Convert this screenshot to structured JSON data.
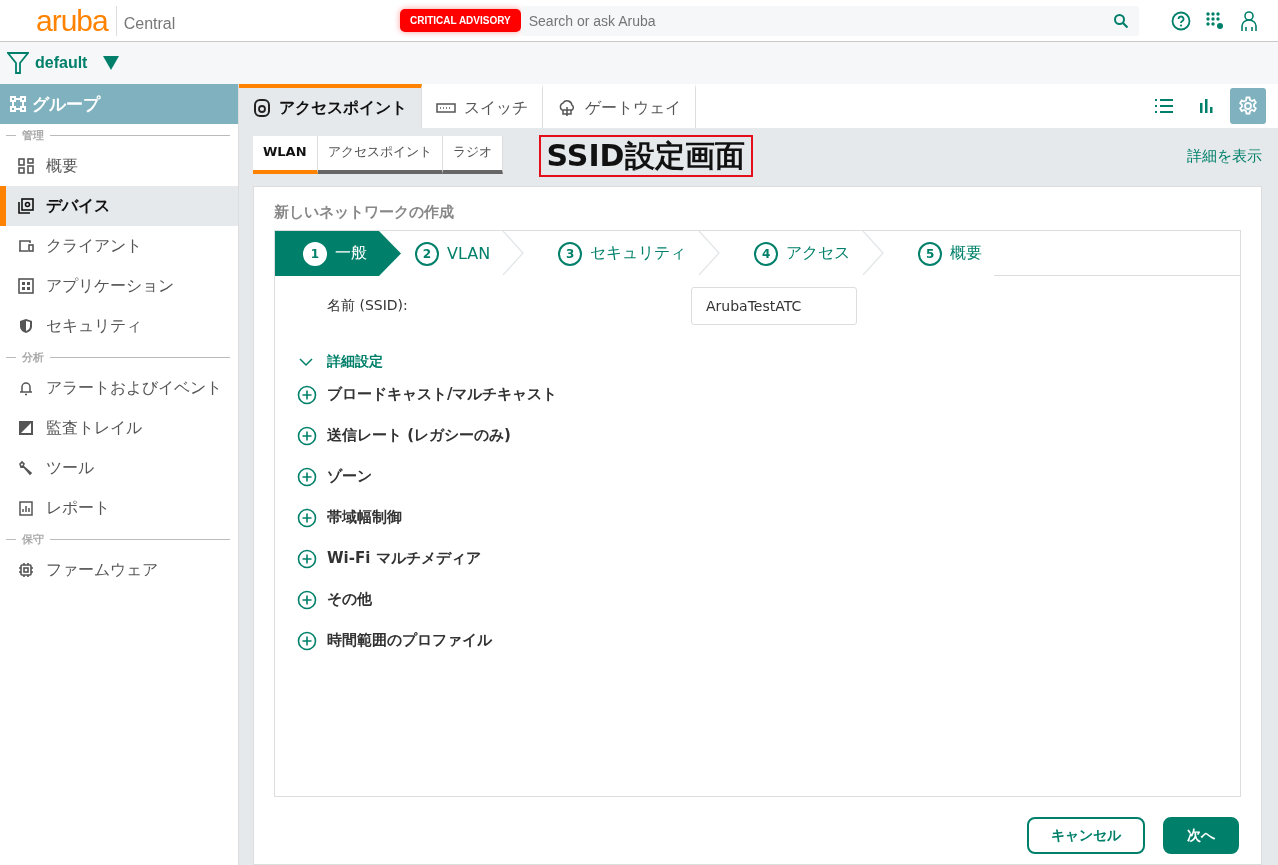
{
  "header": {
    "logo": "aruba",
    "product": "Central",
    "advisory": "CRITICAL ADVISORY",
    "search": {
      "placeholder": "Search or ask Aruba"
    }
  },
  "filter": {
    "label": "default"
  },
  "sidebar": {
    "title": "グループ",
    "sections": [
      {
        "label": "管理",
        "items": [
          {
            "label": "概要",
            "kind": "overview",
            "selected": false
          },
          {
            "label": "デバイス",
            "kind": "devices",
            "selected": true
          },
          {
            "label": "クライアント",
            "kind": "clients",
            "selected": false
          },
          {
            "label": "アプリケーション",
            "kind": "apps",
            "selected": false
          },
          {
            "label": "セキュリティ",
            "kind": "security",
            "selected": false
          }
        ]
      },
      {
        "label": "分析",
        "items": [
          {
            "label": "アラートおよびイベント",
            "kind": "alerts",
            "selected": false
          },
          {
            "label": "監査トレイル",
            "kind": "audit",
            "selected": false
          },
          {
            "label": "ツール",
            "kind": "tools",
            "selected": false
          },
          {
            "label": "レポート",
            "kind": "reports",
            "selected": false
          }
        ]
      },
      {
        "label": "保守",
        "items": [
          {
            "label": "ファームウェア",
            "kind": "firmware",
            "selected": false
          }
        ]
      }
    ]
  },
  "device_tabs": [
    {
      "label": "アクセスポイント",
      "kind": "ap",
      "selected": true
    },
    {
      "label": "スイッチ",
      "kind": "switch",
      "selected": false
    },
    {
      "label": "ゲートウェイ",
      "kind": "gateway",
      "selected": false
    }
  ],
  "view_buttons": [
    {
      "kind": "list",
      "selected": false
    },
    {
      "kind": "chart",
      "selected": false
    },
    {
      "kind": "settings",
      "selected": true
    }
  ],
  "sub_tabs": [
    {
      "label": "WLAN",
      "selected": true
    },
    {
      "label": "アクセスポイント",
      "selected": false
    },
    {
      "label": "ラジオ",
      "selected": false
    }
  ],
  "annotation": "SSID設定画面",
  "details_link": "詳細を表示",
  "wizard": {
    "title": "新しいネットワークの作成",
    "steps": [
      {
        "number": "1",
        "label": "一般",
        "selected": true
      },
      {
        "number": "2",
        "label": "VLAN",
        "selected": false
      },
      {
        "number": "3",
        "label": "セキュリティ",
        "selected": false
      },
      {
        "number": "4",
        "label": "アクセス",
        "selected": false
      },
      {
        "number": "5",
        "label": "概要",
        "selected": false
      }
    ],
    "name_field": {
      "label": "名前 (SSID):",
      "value": "ArubaTestATC"
    },
    "advanced": {
      "label": "詳細設定",
      "expanded": true
    },
    "sections": [
      {
        "label": "ブロードキャスト/マルチキャスト",
        "expanded": false
      },
      {
        "label": "送信レート (レガシーのみ)",
        "expanded": false
      },
      {
        "label": "ゾーン",
        "expanded": false
      },
      {
        "label": "帯域幅制御",
        "expanded": false
      },
      {
        "label": "Wi-Fi マルチメディア",
        "expanded": false
      },
      {
        "label": "その他",
        "expanded": false
      },
      {
        "label": "時間範囲のプロファイル",
        "expanded": false
      }
    ],
    "buttons": [
      {
        "label": "キャンセル",
        "kind": "secondary"
      },
      {
        "label": "次へ",
        "kind": "primary"
      }
    ]
  }
}
